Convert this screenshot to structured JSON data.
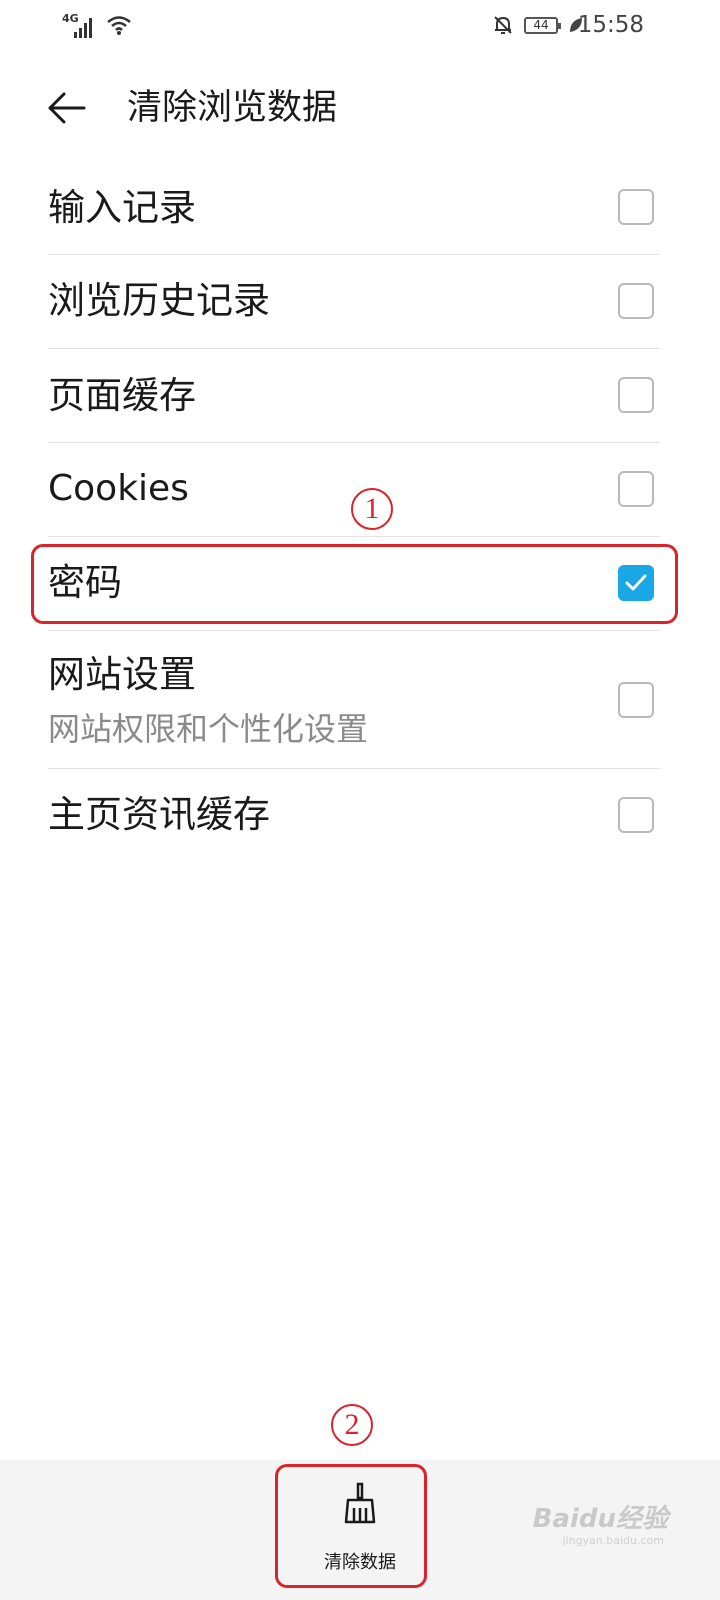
{
  "status_bar": {
    "network": "4G",
    "battery": "44",
    "time": "15:58"
  },
  "header": {
    "title": "清除浏览数据"
  },
  "items": [
    {
      "label": "输入记录",
      "checked": false
    },
    {
      "label": "浏览历史记录",
      "checked": false
    },
    {
      "label": "页面缓存",
      "checked": false
    },
    {
      "label": "Cookies",
      "checked": false
    },
    {
      "label": "密码",
      "checked": true
    },
    {
      "label": "网站设置",
      "sublabel": "网站权限和个性化设置",
      "checked": false
    },
    {
      "label": "主页资讯缓存",
      "checked": false
    }
  ],
  "annotations": {
    "step1": "1",
    "step2": "2",
    "color": "#d8252b"
  },
  "bottom": {
    "clear_label": "清除数据"
  },
  "watermark": {
    "text": "Baidu经验",
    "sub": "jingyan.baidu.com"
  },
  "colors": {
    "accent": "#1aa7e6"
  }
}
